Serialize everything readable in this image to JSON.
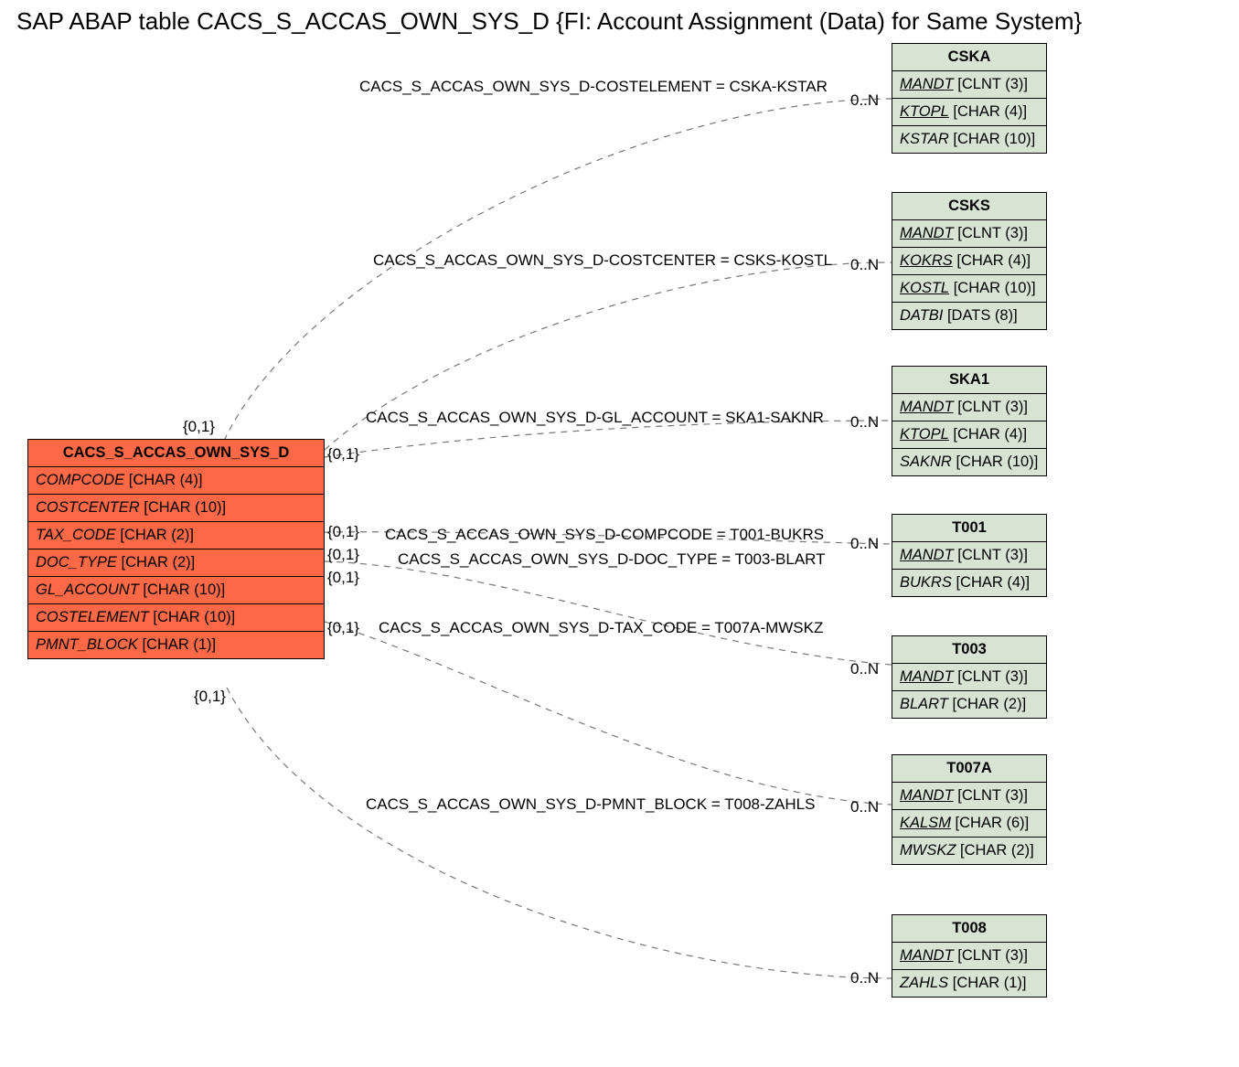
{
  "title": "SAP ABAP table CACS_S_ACCAS_OWN_SYS_D {FI: Account Assignment (Data) for Same System}",
  "source": {
    "name": "CACS_S_ACCAS_OWN_SYS_D",
    "fields": [
      {
        "name": "COMPCODE",
        "type": "[CHAR (4)]",
        "key": false
      },
      {
        "name": "COSTCENTER",
        "type": "[CHAR (10)]",
        "key": false
      },
      {
        "name": "TAX_CODE",
        "type": "[CHAR (2)]",
        "key": false
      },
      {
        "name": "DOC_TYPE",
        "type": "[CHAR (2)]",
        "key": false
      },
      {
        "name": "GL_ACCOUNT",
        "type": "[CHAR (10)]",
        "key": false
      },
      {
        "name": "COSTELEMENT",
        "type": "[CHAR (10)]",
        "key": false
      },
      {
        "name": "PMNT_BLOCK",
        "type": "[CHAR (1)]",
        "key": false
      }
    ]
  },
  "targets": [
    {
      "name": "CSKA",
      "fields": [
        {
          "name": "MANDT",
          "type": "[CLNT (3)]",
          "key": true
        },
        {
          "name": "KTOPL",
          "type": "[CHAR (4)]",
          "key": true
        },
        {
          "name": "KSTAR",
          "type": "[CHAR (10)]",
          "key": false
        }
      ]
    },
    {
      "name": "CSKS",
      "fields": [
        {
          "name": "MANDT",
          "type": "[CLNT (3)]",
          "key": true
        },
        {
          "name": "KOKRS",
          "type": "[CHAR (4)]",
          "key": true
        },
        {
          "name": "KOSTL",
          "type": "[CHAR (10)]",
          "key": true
        },
        {
          "name": "DATBI",
          "type": "[DATS (8)]",
          "key": false
        }
      ]
    },
    {
      "name": "SKA1",
      "fields": [
        {
          "name": "MANDT",
          "type": "[CLNT (3)]",
          "key": true
        },
        {
          "name": "KTOPL",
          "type": "[CHAR (4)]",
          "key": true
        },
        {
          "name": "SAKNR",
          "type": "[CHAR (10)]",
          "key": false
        }
      ]
    },
    {
      "name": "T001",
      "fields": [
        {
          "name": "MANDT",
          "type": "[CLNT (3)]",
          "key": true
        },
        {
          "name": "BUKRS",
          "type": "[CHAR (4)]",
          "key": false
        }
      ]
    },
    {
      "name": "T003",
      "fields": [
        {
          "name": "MANDT",
          "type": "[CLNT (3)]",
          "key": true
        },
        {
          "name": "BLART",
          "type": "[CHAR (2)]",
          "key": false
        }
      ]
    },
    {
      "name": "T007A",
      "fields": [
        {
          "name": "MANDT",
          "type": "[CLNT (3)]",
          "key": true
        },
        {
          "name": "KALSM",
          "type": "[CHAR (6)]",
          "key": true
        },
        {
          "name": "MWSKZ",
          "type": "[CHAR (2)]",
          "key": false
        }
      ]
    },
    {
      "name": "T008",
      "fields": [
        {
          "name": "MANDT",
          "type": "[CLNT (3)]",
          "key": true
        },
        {
          "name": "ZAHLS",
          "type": "[CHAR (1)]",
          "key": false
        }
      ]
    }
  ],
  "relations": [
    {
      "label": "CACS_S_ACCAS_OWN_SYS_D-COSTELEMENT = CSKA-KSTAR",
      "src_card": "{0,1}",
      "tgt_card": "0..N"
    },
    {
      "label": "CACS_S_ACCAS_OWN_SYS_D-COSTCENTER = CSKS-KOSTL",
      "src_card": "{0,1}",
      "tgt_card": "0..N"
    },
    {
      "label": "CACS_S_ACCAS_OWN_SYS_D-GL_ACCOUNT = SKA1-SAKNR",
      "src_card": "{0,1}",
      "tgt_card": "0..N"
    },
    {
      "label": "CACS_S_ACCAS_OWN_SYS_D-COMPCODE = T001-BUKRS",
      "src_card": "{0,1}",
      "tgt_card": "0..N"
    },
    {
      "label": "CACS_S_ACCAS_OWN_SYS_D-DOC_TYPE = T003-BLART",
      "src_card": "{0,1}",
      "tgt_card": "0..N"
    },
    {
      "label": "CACS_S_ACCAS_OWN_SYS_D-TAX_CODE = T007A-MWSKZ",
      "src_card": "{0,1}",
      "tgt_card": "0..N"
    },
    {
      "label": "CACS_S_ACCAS_OWN_SYS_D-PMNT_BLOCK = T008-ZAHLS",
      "src_card": "{0,1}",
      "tgt_card": "0..N"
    }
  ]
}
